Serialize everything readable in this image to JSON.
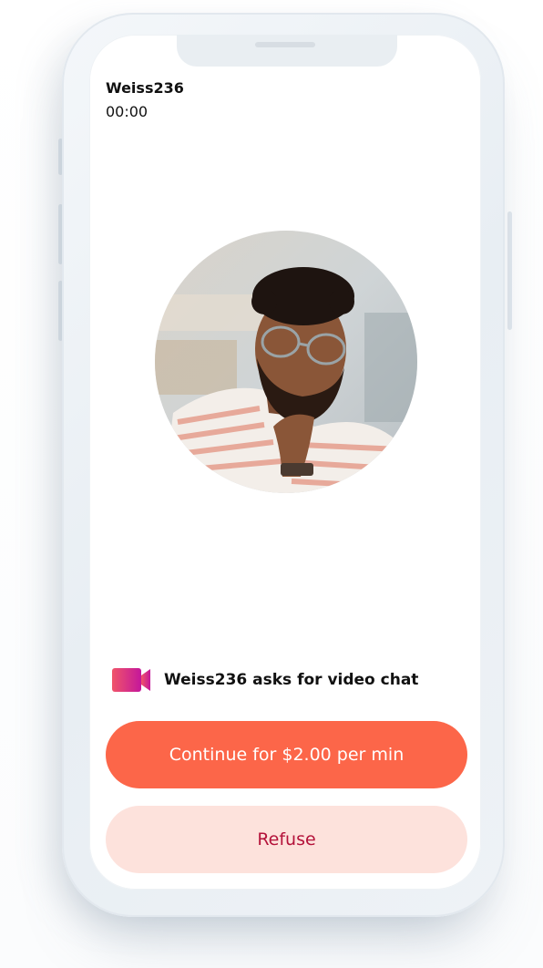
{
  "call": {
    "caller": "Weiss236",
    "timer": "00:00"
  },
  "request": {
    "icon": "video-camera-icon",
    "text": "Weiss236 asks for video chat"
  },
  "actions": {
    "continue_label": "Continue for $2.00 per min",
    "refuse_label": "Refuse"
  },
  "colors": {
    "accent": "#fc6649",
    "refuse_bg": "#fde2dc",
    "refuse_text": "#b4123a",
    "icon_gradient": [
      "#f0556a",
      "#c4169b"
    ]
  }
}
